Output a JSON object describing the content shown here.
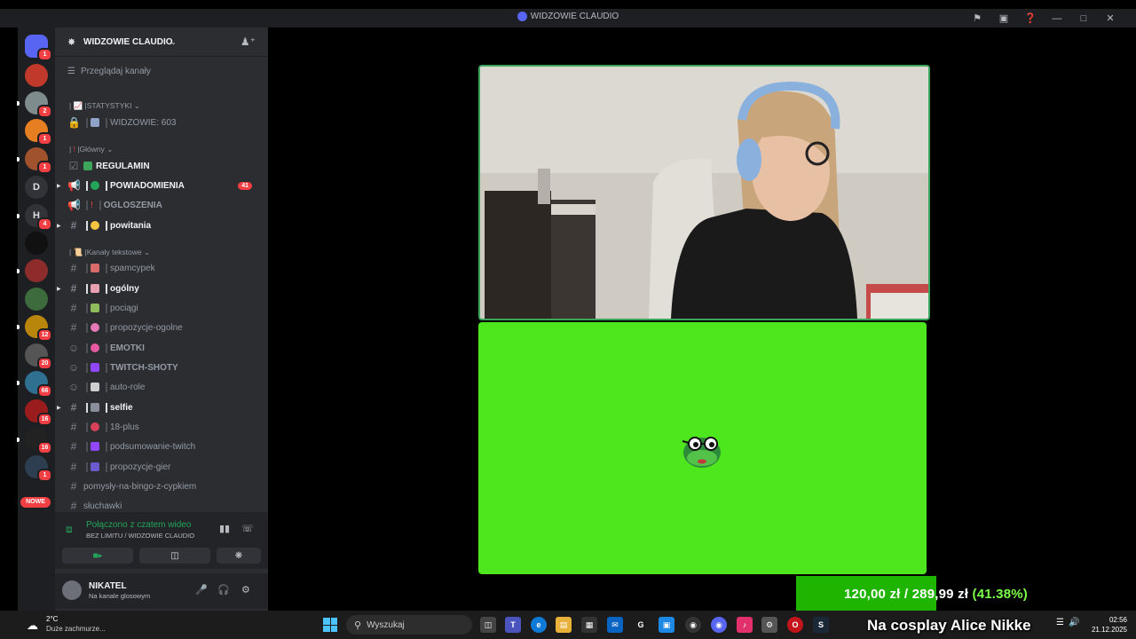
{
  "window": {
    "title": "WIDZOWIE CLAUDIO"
  },
  "servers": {
    "items": [
      {
        "name": "direct-messages",
        "badge": "1",
        "color": "#5865f2",
        "letter": ""
      },
      {
        "name": "server-1",
        "badge": "",
        "color": "#c0392b",
        "letter": ""
      },
      {
        "name": "server-2",
        "badge": "2",
        "color": "#7f8c8d",
        "letter": ""
      },
      {
        "name": "server-3",
        "badge": "1",
        "color": "#e67e22",
        "letter": ""
      },
      {
        "name": "server-4",
        "badge": "1",
        "color": "#a0522d",
        "letter": ""
      },
      {
        "name": "server-d",
        "badge": "",
        "color": "#313338",
        "letter": "D"
      },
      {
        "name": "server-h",
        "badge": "4",
        "color": "#313338",
        "letter": "H"
      },
      {
        "name": "server-x",
        "badge": "",
        "color": "#111",
        "letter": ""
      },
      {
        "name": "server-5",
        "badge": "",
        "color": "#8e2c2c",
        "letter": ""
      },
      {
        "name": "server-6",
        "badge": "",
        "color": "#3d6b3d",
        "letter": ""
      },
      {
        "name": "server-7",
        "badge": "12",
        "color": "#b8860b",
        "letter": ""
      },
      {
        "name": "server-8",
        "badge": "20",
        "color": "#555",
        "letter": ""
      },
      {
        "name": "server-9",
        "badge": "66",
        "color": "#2f6f8f",
        "letter": ""
      },
      {
        "name": "server-10",
        "badge": "16",
        "color": "#9b1c1c",
        "letter": ""
      },
      {
        "name": "server-11",
        "badge": "16",
        "color": "#222",
        "letter": ""
      },
      {
        "name": "server-12",
        "badge": "1",
        "color": "#2c3e50",
        "letter": ""
      }
    ],
    "nowe": "NOWE"
  },
  "sidebar": {
    "server_name": "WIDZOWIE CLAUDIO",
    "browse": "Przeglądaj kanały",
    "categories": {
      "statystyki": "STATYSTYKI",
      "glowny": "Główny",
      "tekstowe": "Kanały tekstowe"
    },
    "channels": {
      "widzowie": "WIDZOWIE: 603",
      "regulamin": "REGULAMIN",
      "powiadomienia": "POWIADOMIENIA",
      "powiadomienia_count": "41",
      "ogloszenia": "OGLOSZENIA",
      "powitania": "powitania",
      "spamcypek": "spamcypek",
      "ogolny": "ogólny",
      "pociagi": "pociągi",
      "propozycje_ogolne": "propozycje-ogolne",
      "emotki": "EMOTKI",
      "twitch_shoty": "TWITCH-SHOTY",
      "auto_role": "auto-role",
      "selfie": "selfie",
      "plus18": "18-plus",
      "podsumowanie": "podsumowanie-twitch",
      "propozycje_gier": "propozycje-gier",
      "bingo": "pomysły-na-bingo-z-cypkiem",
      "sluchawki": "słuchawki"
    }
  },
  "voice": {
    "status": "Połączono z czatem wideo",
    "location": "BEZ LIMITU / WIDZOWIE CLAUDIO"
  },
  "user": {
    "name": "NIKATEL",
    "status": "Na kanale glosowym"
  },
  "taskbar": {
    "temp": "2°C",
    "weather": "Duże zachmurze...",
    "search_placeholder": "Wyszukaj",
    "time": "02:56",
    "date": "21.12.2025"
  },
  "overlay": {
    "goal_current": "120,00 zł",
    "goal_sep": "/",
    "goal_target": "289,99 zł",
    "goal_pct": "(41.38%)",
    "goal_progress": 0.4138,
    "ticker": "Na cosplay Alice Nikke"
  },
  "colors": {
    "accent": "#5865f2",
    "online": "#23a55a",
    "mention": "#f23f43",
    "greenscreen": "#4ee61d"
  }
}
